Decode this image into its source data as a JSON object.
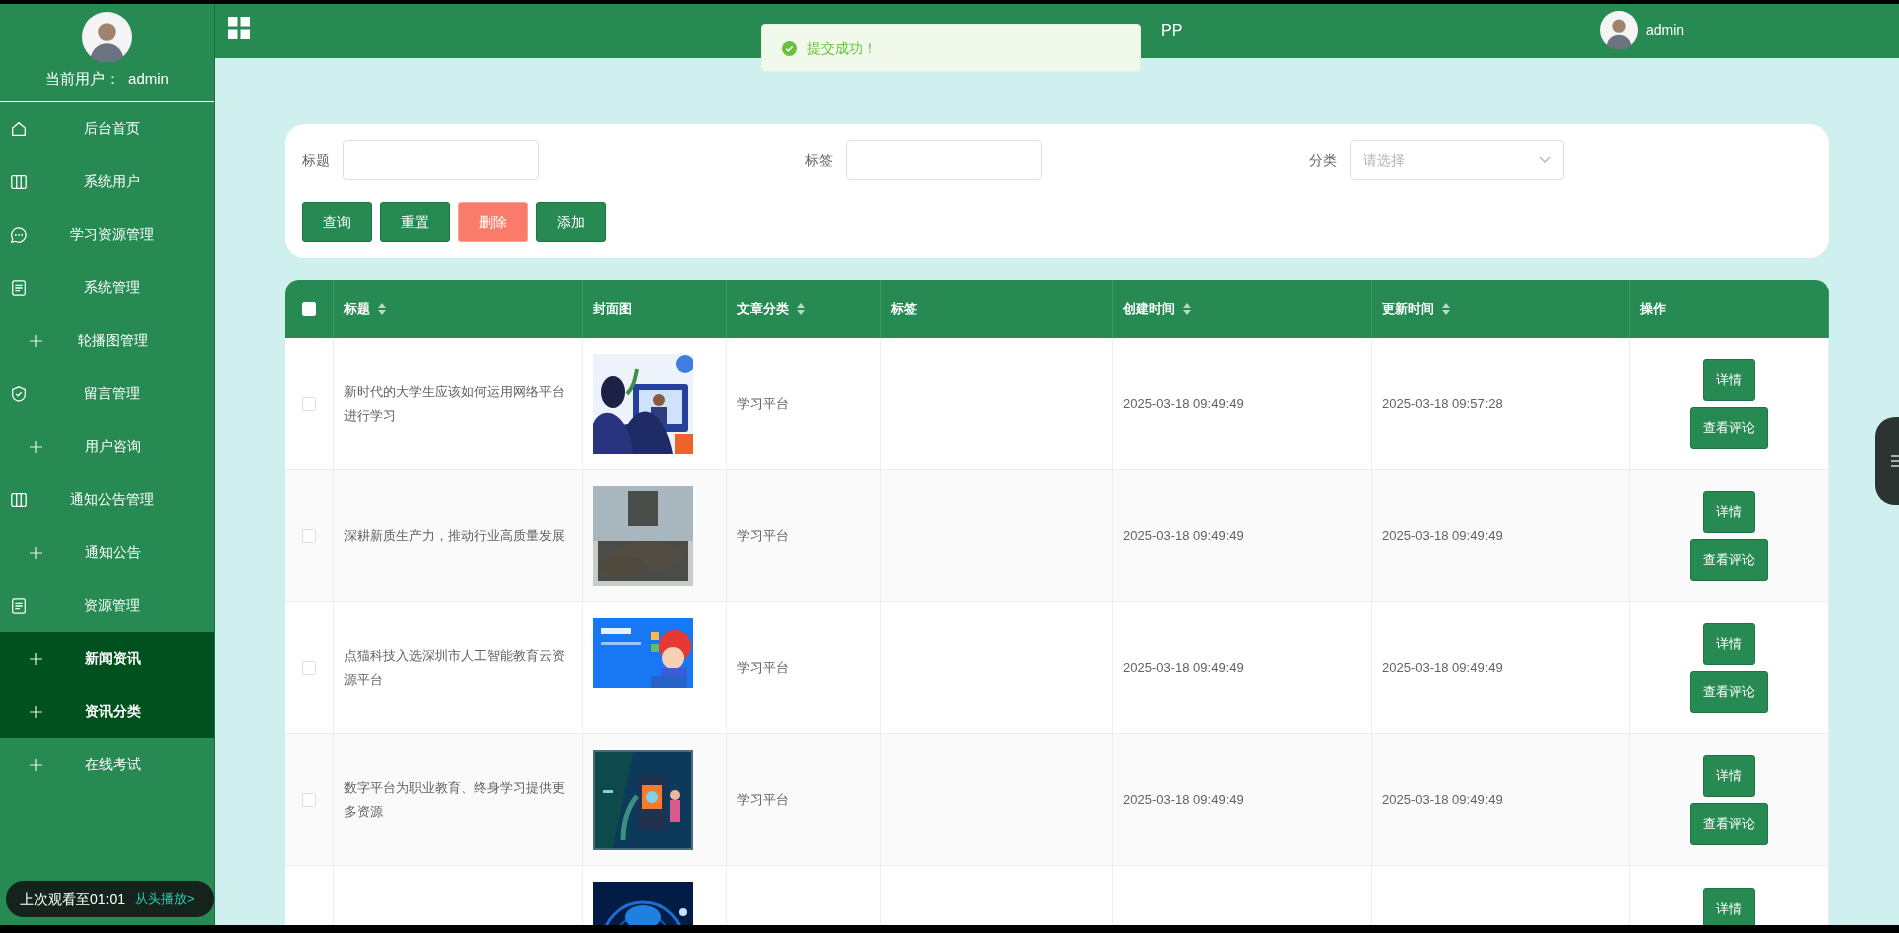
{
  "sidebar": {
    "user_label": "当前用户：",
    "user_name": "admin",
    "items": [
      {
        "kind": "group",
        "label": "后台首页",
        "selected": false
      },
      {
        "kind": "group",
        "label": "系统用户",
        "selected": false
      },
      {
        "kind": "group",
        "label": "学习资源管理",
        "selected": false
      },
      {
        "kind": "group",
        "label": "系统管理",
        "selected": false
      },
      {
        "kind": "sub",
        "label": "轮播图管理",
        "selected": false
      },
      {
        "kind": "group",
        "label": "留言管理",
        "selected": false
      },
      {
        "kind": "sub",
        "label": "用户咨询",
        "selected": false
      },
      {
        "kind": "group",
        "label": "通知公告管理",
        "selected": false
      },
      {
        "kind": "sub",
        "label": "通知公告",
        "selected": false
      },
      {
        "kind": "group",
        "label": "资源管理",
        "selected": false
      },
      {
        "kind": "sub",
        "label": "新闻资讯",
        "selected": true
      },
      {
        "kind": "sub",
        "label": "资讯分类",
        "selected": true
      },
      {
        "kind": "sub",
        "label": "在线考试",
        "selected": false
      }
    ]
  },
  "header": {
    "title_visible": "PP",
    "user_name": "admin"
  },
  "toast": {
    "message": "提交成功！"
  },
  "search": {
    "fields": [
      {
        "kind": "input",
        "label": "标题"
      },
      {
        "kind": "input",
        "label": "标签"
      },
      {
        "kind": "select",
        "label": "分类",
        "placeholder": "请选择"
      }
    ],
    "buttons": [
      {
        "label": "查询",
        "kind": "primary"
      },
      {
        "label": "重置",
        "kind": "primary"
      },
      {
        "label": "删除",
        "kind": "danger"
      },
      {
        "label": "添加",
        "kind": "primary"
      }
    ]
  },
  "table": {
    "select_all_checked": false,
    "columns": [
      {
        "label": "标题",
        "sortable": true
      },
      {
        "label": "封面图",
        "sortable": false
      },
      {
        "label": "文章分类",
        "sortable": true
      },
      {
        "label": "标签",
        "sortable": false
      },
      {
        "label": "创建时间",
        "sortable": true
      },
      {
        "label": "更新时间",
        "sortable": true
      },
      {
        "label": "操作",
        "sortable": false
      }
    ],
    "rows": [
      {
        "checked": false,
        "title": "新时代的大学生应该如何运用网络平台进行学习",
        "cover": {
          "kind": "picture"
        },
        "category": "学习平台",
        "created": "2025-03-18 09:49:49",
        "updated": "2025-03-18 09:57:28",
        "buttons": [
          "详情",
          "查看评论"
        ]
      },
      {
        "checked": false,
        "title": "深耕新质生产力，推动行业高质量发展",
        "cover": {
          "kind": "picture"
        },
        "category": "学习平台",
        "created": "2025-03-18 09:49:49",
        "updated": "2025-03-18 09:49:49",
        "buttons": [
          "详情",
          "查看评论"
        ]
      },
      {
        "checked": false,
        "title": "点猫科技入选深圳市人工智能教育云资源平台",
        "cover": {
          "kind": "picture"
        },
        "category": "学习平台",
        "created": "2025-03-18 09:49:49",
        "updated": "2025-03-18 09:49:49",
        "buttons": [
          "详情",
          "查看评论"
        ]
      },
      {
        "checked": false,
        "title": "数字平台为职业教育、终身学习提供更多资源",
        "cover": {
          "kind": "picture"
        },
        "category": "学习平台",
        "created": "2025-03-18 09:49:49",
        "updated": "2025-03-18 09:49:49",
        "buttons": [
          "详情",
          "查看评论"
        ]
      },
      {
        "cover": {
          "kind": "picture"
        },
        "buttons": [
          "详情"
        ]
      }
    ]
  },
  "video_resume": {
    "text": "上次观看至01:01",
    "link": "从头播放>"
  }
}
